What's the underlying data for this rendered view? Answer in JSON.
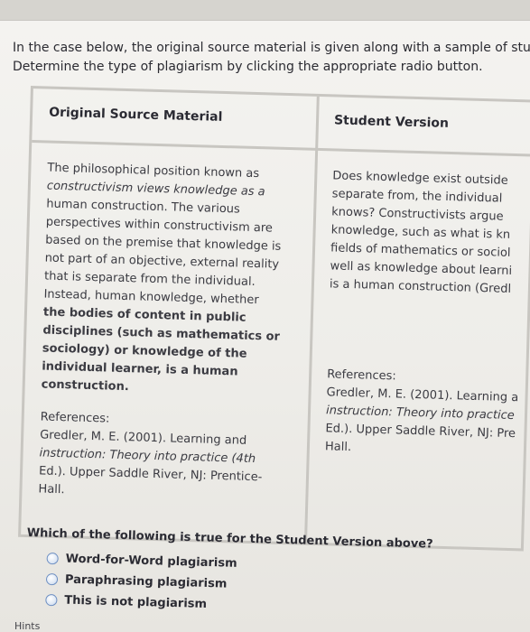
{
  "instructions": {
    "line1": "In the case below, the original source material is given along with a sample of stu",
    "line2": "Determine the type of plagiarism by clicking the appropriate radio button."
  },
  "table": {
    "header_original": "Original Source Material",
    "header_student": "Student Version",
    "original_lines": [
      "The philosophical position known as",
      "constructivism views knowledge as a",
      "human construction. The various",
      "perspectives within constructivism are",
      "based on the premise that knowledge is",
      "not part of an objective, external reality",
      "that is separate from the individual.",
      "Instead, human knowledge, whether",
      "the bodies of content in public",
      "disciplines (such as mathematics or",
      "sociology) or knowledge of the",
      "individual learner, is a human",
      "construction."
    ],
    "original_refs": {
      "label": "References:",
      "lines": [
        "Gredler, M. E. (2001). Learning and",
        "instruction: Theory into practice (4th",
        "Ed.). Upper Saddle River, NJ: Prentice-",
        "Hall."
      ]
    },
    "student_lines": [
      "Does knowledge exist outside",
      "separate from, the individual",
      "knows? Constructivists argue",
      "knowledge, such as what is kn",
      "fields of mathematics or sociol",
      "well as knowledge about learni",
      "is a human construction (Gredl"
    ],
    "student_refs": {
      "label": "References:",
      "lines": [
        "Gredler, M. E. (2001). Learning a",
        "instruction: Theory into practice",
        "Ed.). Upper Saddle River, NJ: Pre",
        "Hall."
      ]
    }
  },
  "question": {
    "text": "Which of the following is true for the Student Version above?",
    "options": [
      "Word-for-Word plagiarism",
      "Paraphrasing plagiarism",
      "This is not plagiarism"
    ]
  },
  "hints_label": "Hints"
}
